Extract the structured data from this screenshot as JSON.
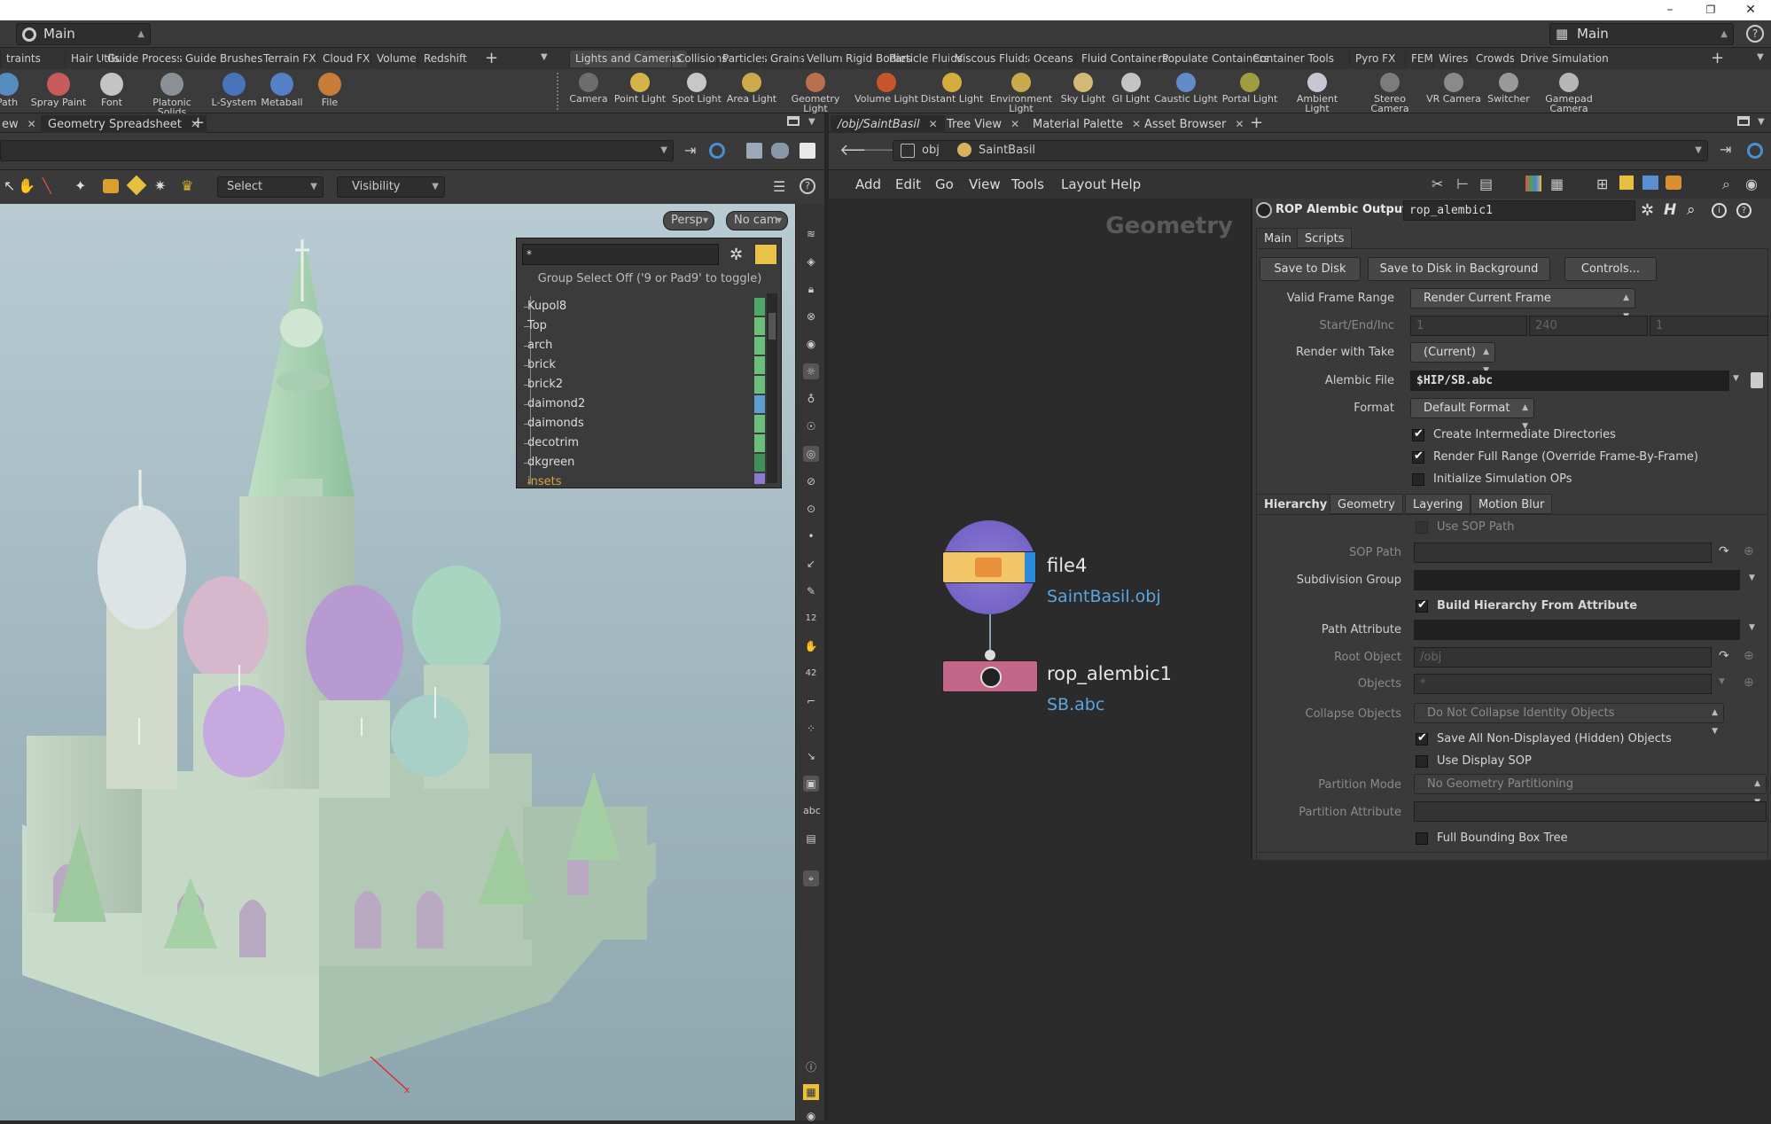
{
  "window": {
    "minimize": "–",
    "restore": "❐",
    "close": "✕"
  },
  "desktop": {
    "left": "Main",
    "right": "Main"
  },
  "shelf_tabs_left": [
    "traints",
    "Hair Utils",
    "Guide Process",
    "Guide Brushes",
    "Terrain FX",
    "Cloud FX",
    "Volume",
    "Redshift"
  ],
  "shelf_tabs_right": [
    "Lights and Cameras",
    "Collisions",
    "Particles",
    "Grains",
    "Vellum",
    "Rigid Bodies",
    "Particle Fluids",
    "Viscous Fluids",
    "Oceans",
    "Fluid Containers",
    "Populate Containers",
    "Container Tools",
    "Pyro FX",
    "FEM",
    "Wires",
    "Crowds",
    "Drive Simulation"
  ],
  "tools_left": [
    {
      "label": "Path",
      "icon": "path-icon",
      "color": "#5b9bd5"
    },
    {
      "label": "Spray Paint",
      "icon": "spray-paint-icon",
      "color": "#e06060"
    },
    {
      "label": "Font",
      "icon": "font-icon",
      "color": "#dddddd"
    },
    {
      "label": "Platonic Solids",
      "icon": "platonic-solids-icon",
      "color": "#9aa0a8"
    },
    {
      "label": "L-System",
      "icon": "l-system-icon",
      "color": "#4a7fd0"
    },
    {
      "label": "Metaball",
      "icon": "metaball-icon",
      "color": "#5a8ce0"
    },
    {
      "label": "File",
      "icon": "file-icon",
      "color": "#e08a3a"
    }
  ],
  "tools_right": [
    {
      "label": "Camera",
      "icon": "camera-icon",
      "color": "#777777"
    },
    {
      "label": "Point Light",
      "icon": "point-light-icon",
      "color": "#f2c94c"
    },
    {
      "label": "Spot Light",
      "icon": "spot-light-icon",
      "color": "#e0e0e0"
    },
    {
      "label": "Area Light",
      "icon": "area-light-icon",
      "color": "#e8c050"
    },
    {
      "label": "Geometry Light",
      "icon": "geometry-light-icon",
      "color": "#d07a50"
    },
    {
      "label": "Volume Light",
      "icon": "volume-light-icon",
      "color": "#e05a2a"
    },
    {
      "label": "Distant Light",
      "icon": "distant-light-icon",
      "color": "#f0c040"
    },
    {
      "label": "Environment Light",
      "icon": "environment-light-icon",
      "color": "#e0c050"
    },
    {
      "label": "Sky Light",
      "icon": "sky-light-icon",
      "color": "#f0d080"
    },
    {
      "label": "GI Light",
      "icon": "gi-light-icon",
      "color": "#dddddd"
    },
    {
      "label": "Caustic Light",
      "icon": "caustic-light-icon",
      "color": "#6a9ae0"
    },
    {
      "label": "Portal Light",
      "icon": "portal-light-icon",
      "color": "#b0b040"
    },
    {
      "label": "Ambient Light",
      "icon": "ambient-light-icon",
      "color": "#e0e0f0"
    },
    {
      "label": "Stereo Camera",
      "icon": "stereo-camera-icon",
      "color": "#888888"
    },
    {
      "label": "VR Camera",
      "icon": "vr-camera-icon",
      "color": "#999999"
    },
    {
      "label": "Switcher",
      "icon": "switcher-icon",
      "color": "#aaaaaa"
    },
    {
      "label": "Gamepad Camera",
      "icon": "gamepad-camera-icon",
      "color": "#cccccc"
    }
  ],
  "left_tabs": [
    {
      "label": "ew"
    },
    {
      "label": "Geometry Spreadsheet"
    }
  ],
  "right_tabs": [
    {
      "label": "/obj/SaintBasil"
    },
    {
      "label": "Tree View"
    },
    {
      "label": "Material Palette"
    },
    {
      "label": "Asset Browser"
    }
  ],
  "viewport": {
    "select_label": "Select",
    "visibility_label": "Visibility",
    "persp": "Persp",
    "nocam": "No cam",
    "axis_x": "x"
  },
  "group_panel": {
    "filter": "*",
    "hint": "Group Select Off ('9 or Pad9' to toggle)",
    "items": [
      {
        "name": "Kupol8",
        "color": "#4fa86a"
      },
      {
        "name": "Top",
        "color": "#6abf7a"
      },
      {
        "name": "arch",
        "color": "#6abf7a"
      },
      {
        "name": "brick",
        "color": "#6abf7a"
      },
      {
        "name": "brick2",
        "color": "#6abf7a"
      },
      {
        "name": "daimond2",
        "color": "#5a9fcf"
      },
      {
        "name": "daimonds",
        "color": "#6abf7a"
      },
      {
        "name": "decotrim",
        "color": "#6abf7a"
      },
      {
        "name": "dkgreen",
        "color": "#3e8f58"
      },
      {
        "name": "insets",
        "color": "#8a7ad0"
      }
    ]
  },
  "network": {
    "path_obj": "obj",
    "path_node": "SaintBasil",
    "menu": [
      "Add",
      "Edit",
      "Go",
      "View",
      "Tools",
      "Layout",
      "Help"
    ],
    "context_label": "Geometry",
    "nodes": [
      {
        "name": "file4",
        "sub": "SaintBasil.obj"
      },
      {
        "name": "rop_alembic1",
        "sub": "SB.abc"
      }
    ]
  },
  "params": {
    "node_type": "ROP Alembic Output",
    "node_name": "rop_alembic1",
    "tabs": [
      "Main",
      "Scripts"
    ],
    "buttons": [
      "Save to Disk",
      "Save to Disk in Background",
      "Controls..."
    ],
    "valid_frame_range": {
      "label": "Valid Frame Range",
      "value": "Render Current Frame"
    },
    "start_end_inc": {
      "label": "Start/End/Inc",
      "v1": "1",
      "v2": "240",
      "v3": "1"
    },
    "render_with_take": {
      "label": "Render with Take",
      "value": "(Current)"
    },
    "alembic_file": {
      "label": "Alembic File",
      "value": "$HIP/SB.abc"
    },
    "format": {
      "label": "Format",
      "value": "Default Format"
    },
    "checks_main": [
      {
        "label": "Create Intermediate Directories",
        "on": true
      },
      {
        "label": "Render Full Range (Override Frame-By-Frame)",
        "on": true
      },
      {
        "label": "Initialize Simulation OPs",
        "on": false
      }
    ],
    "subtabs": [
      "Hierarchy",
      "Geometry",
      "Layering",
      "Motion Blur"
    ],
    "use_sop_path": "Use SOP Path",
    "sop_path": "SOP Path",
    "subdivision_group": "Subdivision Group",
    "build_hierarchy": "Build Hierarchy From Attribute",
    "path_attribute": "Path Attribute",
    "root_object": {
      "label": "Root Object",
      "value": "/obj"
    },
    "objects": {
      "label": "Objects",
      "value": "*"
    },
    "collapse_objects": {
      "label": "Collapse Objects",
      "value": "Do Not Collapse Identity Objects"
    },
    "save_hidden": "Save All Non-Displayed (Hidden) Objects",
    "use_display_sop": "Use Display SOP",
    "partition_mode": {
      "label": "Partition Mode",
      "value": "No Geometry Partitioning"
    },
    "partition_attribute": "Partition Attribute",
    "full_bbox": "Full Bounding Box Tree"
  }
}
